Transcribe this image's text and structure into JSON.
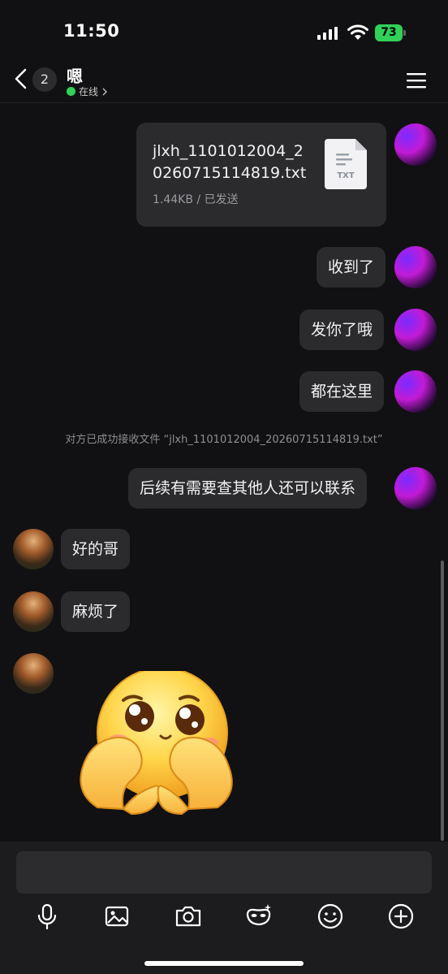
{
  "status_bar": {
    "time": "11:50",
    "battery": "73"
  },
  "header": {
    "unread_count": "2",
    "contact_name": "嗯",
    "presence": "在线"
  },
  "messages": {
    "file": {
      "name": "jlxh_1101012004_20260715114819.txt",
      "meta": "1.44KB / 已发送",
      "icon_label": "TXT"
    },
    "sent_1": "收到了",
    "sent_2": "发你了哦",
    "sent_3": "都在这里",
    "system_note": "对方已成功接收文件 “jlxh_1101012004_20260715114819.txt”",
    "sent_4": "后续有需要查其他人还可以联系",
    "recv_1": "好的哥",
    "recv_2": "麻烦了"
  },
  "composer": {
    "placeholder": "",
    "tools": [
      "microphone-icon",
      "image-icon",
      "camera-icon",
      "magic-mask-icon",
      "emoji-icon",
      "plus-icon"
    ]
  },
  "colors": {
    "accent_green": "#30d158",
    "bubble": "#2b2b2e",
    "background": "#111113"
  }
}
